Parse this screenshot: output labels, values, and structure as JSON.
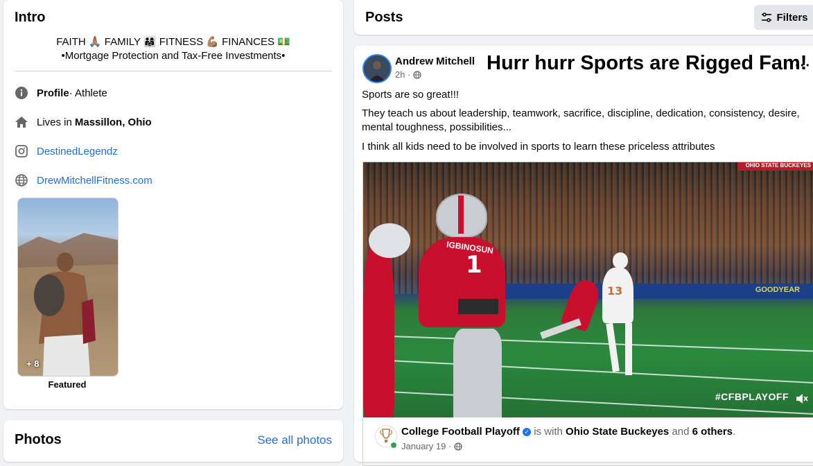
{
  "intro": {
    "title": "Intro",
    "bio_words": [
      "FAITH",
      "FAMILY",
      "FITNESS",
      "FINANCES"
    ],
    "bio_emojis": [
      "🙏🏽",
      "👨‍👩‍👧",
      "💪🏽",
      "💵"
    ],
    "bio_line2": "•Mortgage Protection and Tax-Free Investments•",
    "details": [
      {
        "icon": "info-icon",
        "label": "Profile",
        "value": " · Athlete"
      },
      {
        "icon": "home-icon",
        "label": "Lives in ",
        "value": "Massillon, Ohio"
      },
      {
        "icon": "instagram-icon",
        "label": "DestinedLegendz"
      },
      {
        "icon": "globe-icon",
        "label": "DrewMitchellFitness.com"
      }
    ],
    "featured_count": "+ 8",
    "featured_label": "Featured"
  },
  "photos": {
    "title": "Photos",
    "see_all": "See all photos"
  },
  "posts_header": {
    "title": "Posts",
    "filters_label": "Filters"
  },
  "post": {
    "author": "Andrew Mitchell",
    "time": "2h ·",
    "overlay_caption": "Hurr hurr Sports are Rigged Fam!",
    "text_1": "Sports are so great!!!",
    "text_2": "They teach us about leadership, teamwork, sacrifice, discipline, dedication, consistency, desire, mental toughness, possibilities...",
    "text_3": "I think all kids need to be involved in sports to learn these priceless attributes",
    "video": {
      "hashtag": "#CFBPLAYOFF",
      "board_text": "GOODYEAR",
      "jersey_name": "IGBINOSUN",
      "jersey_number": "1",
      "kicker_number": "13",
      "banner_text": "OHIO STATE BUCKEYES"
    },
    "shared": {
      "page_name": "College Football Playoff",
      "is_with": " is with ",
      "tagged": "Ohio State Buckeyes",
      "and": " and ",
      "others": "6 others",
      "period": ".",
      "date": "January 19 ·"
    }
  },
  "colors": {
    "link": "#216fdb",
    "background": "#f0f2f5",
    "muted": "#65676b",
    "verified": "#1877f2"
  }
}
